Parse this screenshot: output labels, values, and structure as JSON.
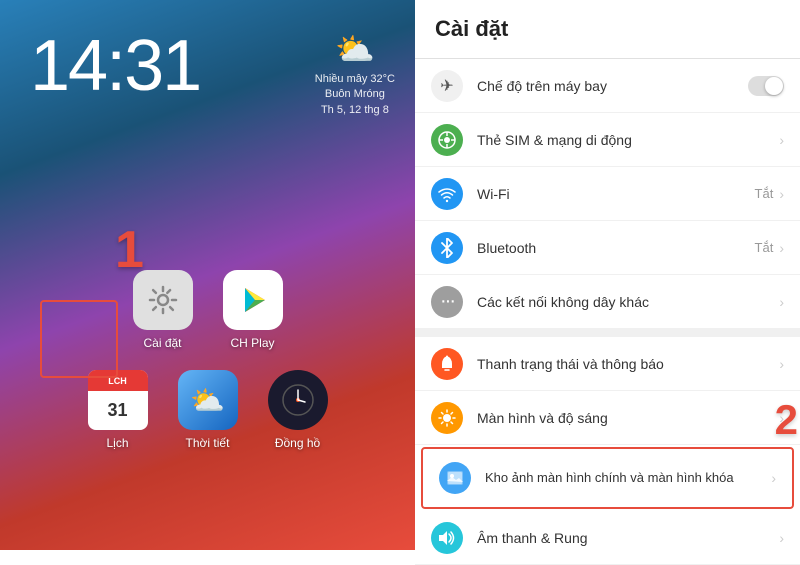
{
  "left": {
    "time": "14:31",
    "weather": {
      "icon": "⛅",
      "line1": "Nhiều mây 32°C",
      "line2": "Buôn Mróng",
      "line3": "Th 5, 12 thg 8"
    },
    "apps_row1": [
      {
        "id": "settings",
        "icon": "⚙️",
        "label": "Cài đặt",
        "bg": "settings-icon-bg"
      },
      {
        "id": "chplay",
        "icon": "▶",
        "label": "CH Play",
        "bg": "chplay-icon-bg"
      }
    ],
    "apps_row2": [
      {
        "id": "calendar",
        "icon": "📅",
        "label": "Lịch",
        "bg": "calendar-icon-bg"
      },
      {
        "id": "weather",
        "icon": "🌤",
        "label": "Thời tiết",
        "bg": "weather-app-icon-bg"
      },
      {
        "id": "clock",
        "icon": "🕐",
        "label": "Đồng hồ",
        "bg": "clock-icon-bg"
      }
    ],
    "annotation_number_1": "1",
    "annotation_number_2": "2"
  },
  "right": {
    "title": "Cài đặt",
    "items": [
      {
        "id": "airplane",
        "icon": "✈",
        "icon_class": "icon-airplane",
        "label": "Chế độ trên máy bay",
        "type": "toggle",
        "value": ""
      },
      {
        "id": "sim",
        "icon": "🌐",
        "icon_class": "icon-sim",
        "label": "Thẻ SIM & mạng di động",
        "type": "chevron",
        "value": ""
      },
      {
        "id": "wifi",
        "icon": "📶",
        "icon_class": "icon-wifi",
        "label": "Wi-Fi",
        "type": "chevron",
        "value": "Tắt"
      },
      {
        "id": "bluetooth",
        "icon": "✱",
        "icon_class": "icon-bluetooth",
        "label": "Bluetooth",
        "type": "chevron",
        "value": "Tắt"
      },
      {
        "id": "connections",
        "icon": "⋯",
        "icon_class": "icon-connections",
        "label": "Các kết nối không dây khác",
        "type": "chevron",
        "value": ""
      },
      {
        "id": "notification",
        "icon": "🔔",
        "icon_class": "icon-notification",
        "label": "Thanh trạng thái và thông báo",
        "type": "chevron",
        "value": ""
      },
      {
        "id": "display",
        "icon": "☀",
        "icon_class": "icon-display",
        "label": "Màn hình và độ sáng",
        "type": "chevron",
        "value": ""
      },
      {
        "id": "wallpaper",
        "icon": "🖼",
        "icon_class": "icon-wallpaper",
        "label": "Kho ảnh màn hình chính và màn hình khóa",
        "type": "chevron",
        "value": "",
        "highlighted": true
      },
      {
        "id": "sound",
        "icon": "🔊",
        "icon_class": "icon-sound",
        "label": "Âm thanh & Rung",
        "type": "chevron",
        "value": ""
      }
    ]
  }
}
